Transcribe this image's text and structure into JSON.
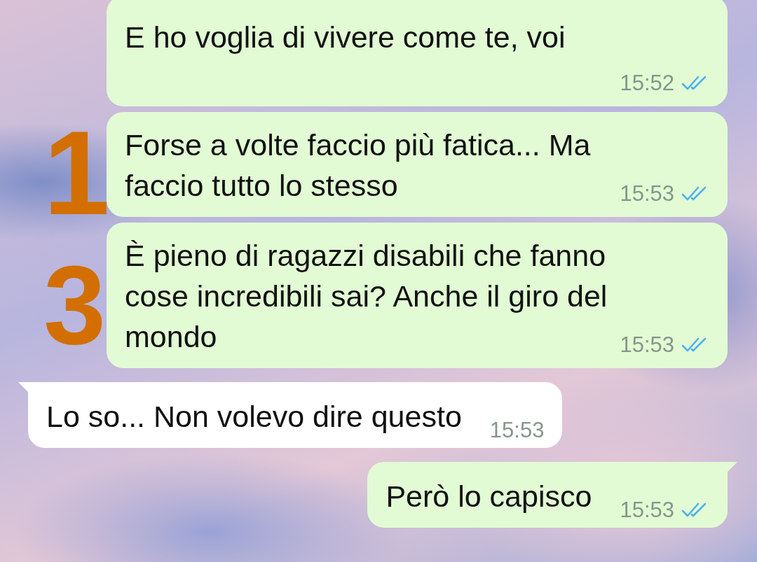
{
  "messages": [
    {
      "kind": "outgoing",
      "text": "E ho voglia di vivere come te, voi",
      "time": "15:52",
      "read": true
    },
    {
      "kind": "outgoing",
      "text": "Forse a volte faccio più fatica... Ma faccio tutto lo stesso",
      "time": "15:53",
      "read": true
    },
    {
      "kind": "outgoing",
      "text": "È pieno di ragazzi disabili che fanno cose incredibili sai? Anche il giro del mondo",
      "time": "15:53",
      "read": true
    },
    {
      "kind": "incoming",
      "text": "Lo so... Non volevo dire questo",
      "time": "15:53"
    },
    {
      "kind": "outgoing",
      "text": "Però lo capisco",
      "time": "15:53",
      "read": true
    }
  ],
  "annotations": [
    "1",
    "3"
  ]
}
